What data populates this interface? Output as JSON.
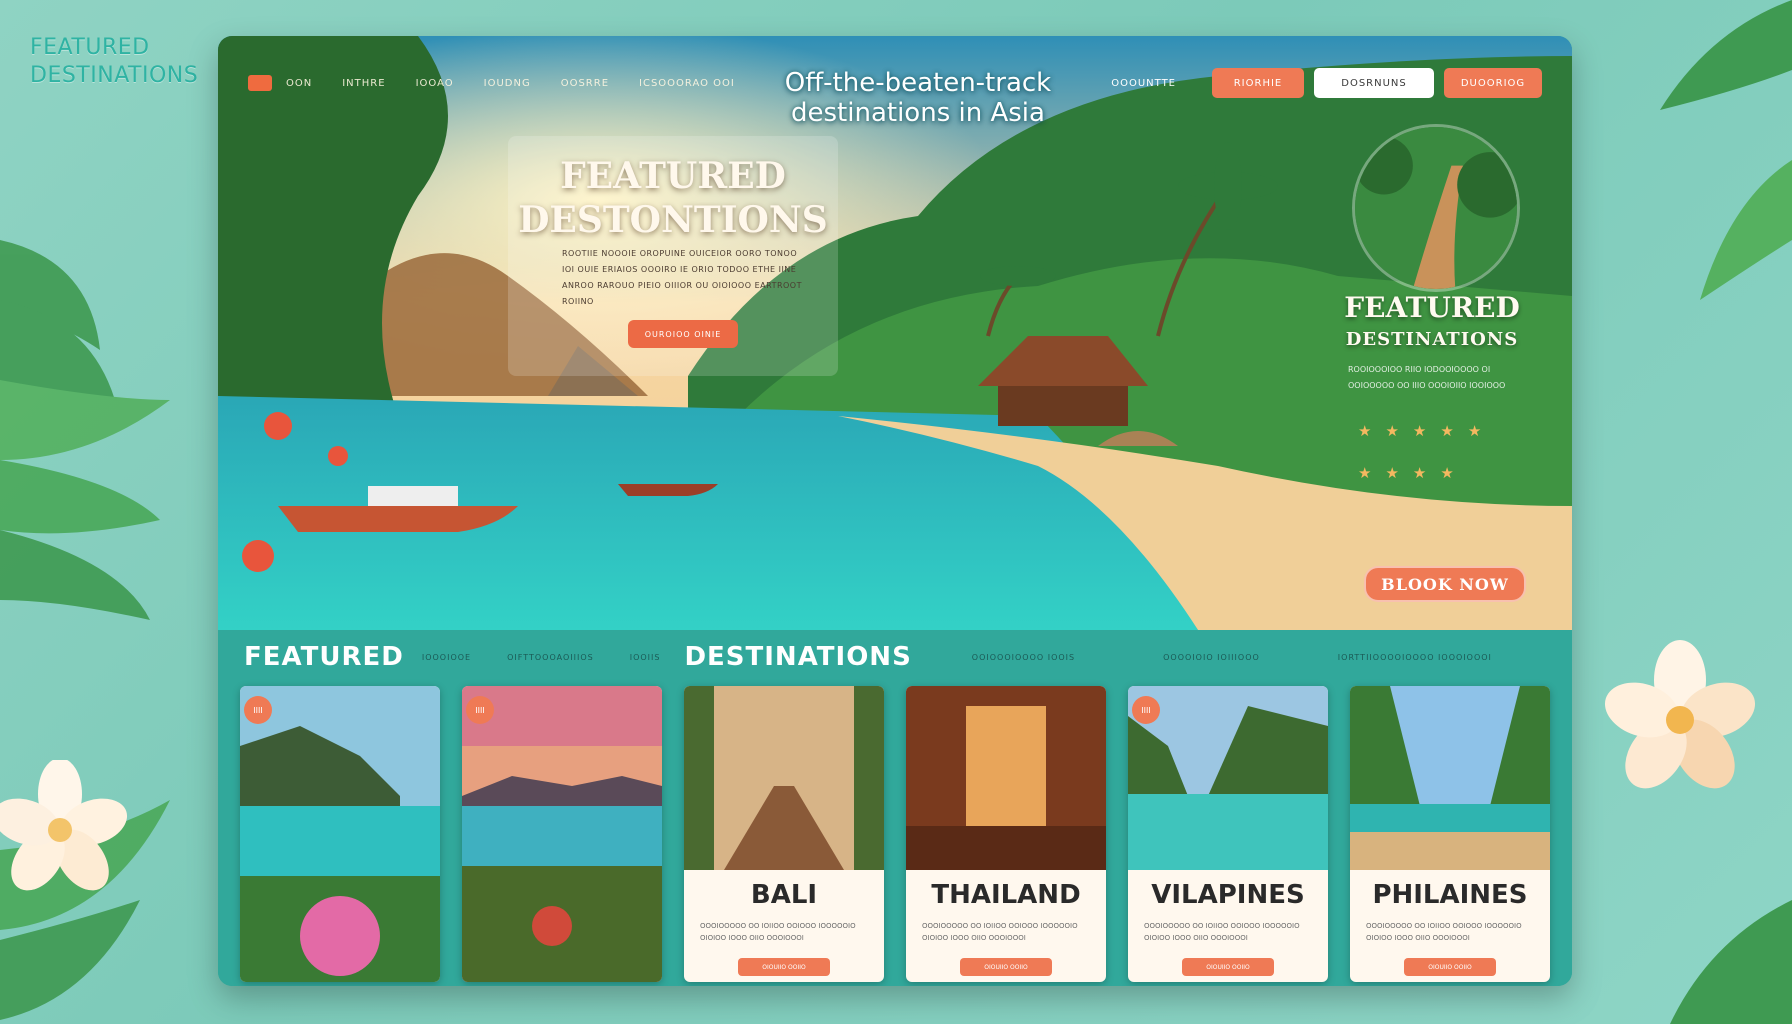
{
  "page": {
    "side_title": "FEATURED DESTINATIONS"
  },
  "nav": {
    "links": [
      "OON",
      "INTHRE",
      "IOOAO",
      "IOUDNG",
      "OOSRRE",
      "ICSOOORAO OOI"
    ],
    "right_text": "OOOUNTTE",
    "pill_1": "RIORHIE",
    "pill_2": "DOSRNUNS",
    "pill_3": "DUOORIOG"
  },
  "hero": {
    "tagline_line1": "Off-the-beaten-track",
    "tagline_line2": "destinations in Asia",
    "title_line1": "FEATURED",
    "title_line2": "DESTONTIONS",
    "desc": "ROOTIIE NOOOIE OROPUINE OUICEIOR OORO TONOO IOI OUIE ERIAIOS OOOIRO IE ORIO TODOO ETHE IINE ANROO RAROUO PIEIO OIIIOR OU OIOIOOO EARTROOT ROIINO",
    "cta": "OUROIOO OINIE",
    "side_title": "FEATURED",
    "side_subtitle": "DESTINATIONS",
    "side_desc": "ROOIOOOIOO RIIO IODOOIOOOO OI OOIOOOOO OO IIIO OOOIOIIO IOOIOOO",
    "book_now": "BLOOK NOW"
  },
  "lower": {
    "heading_1": "FEATURED",
    "small_1": "IOOOIOOE",
    "small_2": "OIFTTOOOAOIIIOS",
    "small_3": "IOOIIS",
    "heading_2": "DESTINATIONS",
    "small_4": "OOIOOOIOOOO IOOIS",
    "small_5": "OOOOIOIO IOIIIOOO",
    "small_6": "IORTTIIOOOOIOOOO IOOOIOOOI"
  },
  "cards": [
    {
      "badge": "IIII",
      "name": "",
      "desc": "",
      "button": ""
    },
    {
      "badge": "IIII",
      "name": "",
      "desc": "",
      "button": ""
    },
    {
      "badge": "",
      "name": "BALI",
      "desc": "OOOIOOOOO OO IOIIOO OOIOOO IOOOOOIO OIOIOO IOOO OIIO OOOIOOOI",
      "button": "OIOUIIO OOIIO"
    },
    {
      "badge": "",
      "name": "THAILAND",
      "desc": "OOOIOOOOO OO IOIIOO OOIOOO IOOOOOIO OIOIOO IOOO OIIO OOOIOOOI",
      "button": "OIOUIIO OOIIO"
    },
    {
      "badge": "IIII",
      "name": "VILAPINES",
      "desc": "OOOIOOOOO OO IOIIOO OOIOOO IOOOOOIO OIOIOO IOOO OIIO OOOIOOOI",
      "button": "OIOUIIO OOIIO"
    },
    {
      "badge": "",
      "name": "PHILAINES",
      "desc": "OOOIOOOOO OO IOIIOO OOIOOO IOOOOOIO OIOIOO IOOO OIIO OOOIOOOI",
      "button": "OIOUIIO OOIIO"
    }
  ],
  "colors": {
    "accent": "#ef7a55",
    "teal": "#31a89b",
    "background": "#8fd3c3"
  }
}
